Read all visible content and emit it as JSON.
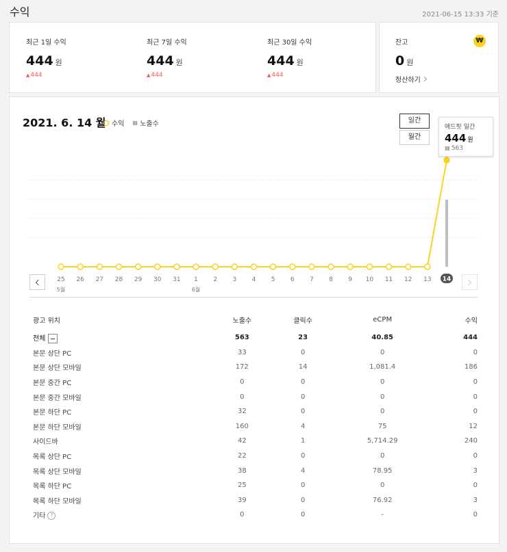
{
  "page": {
    "title": "수익",
    "timestamp": "2021-06-15 13:33 기준"
  },
  "revenue_stats": [
    {
      "label": "최근 1일 수익",
      "value": "444",
      "unit": "원",
      "diff": "444"
    },
    {
      "label": "최근 7일 수익",
      "value": "444",
      "unit": "원",
      "diff": "444"
    },
    {
      "label": "최근 30일 수익",
      "value": "444",
      "unit": "원",
      "diff": "444"
    }
  ],
  "balance": {
    "label": "잔고",
    "value": "0",
    "unit": "원",
    "settle_label": "정산하기",
    "icon": "₩"
  },
  "chart": {
    "date_title": "2021. 6. 14 월",
    "legend_revenue": "수익",
    "legend_impressions": "노출수",
    "btn_daily": "일간",
    "btn_monthly": "월간",
    "tooltip": {
      "title": "애드핏 일간",
      "value": "444",
      "unit": "원",
      "impressions": "563"
    },
    "accent_color": "#fbd21c",
    "bar_color": "#b9bfc4"
  },
  "chart_data": {
    "type": "line",
    "x": [
      "25",
      "26",
      "27",
      "28",
      "29",
      "30",
      "31",
      "1",
      "2",
      "3",
      "4",
      "5",
      "6",
      "7",
      "8",
      "9",
      "10",
      "11",
      "12",
      "13",
      "14"
    ],
    "month_labels": [
      {
        "index": 0,
        "label": "5월"
      },
      {
        "index": 7,
        "label": "6월"
      }
    ],
    "series": [
      {
        "name": "수익",
        "values": [
          0,
          0,
          0,
          0,
          0,
          0,
          0,
          0,
          0,
          0,
          0,
          0,
          0,
          0,
          0,
          0,
          0,
          0,
          0,
          0,
          444
        ]
      },
      {
        "name": "노출수",
        "values": [
          0,
          0,
          0,
          0,
          0,
          0,
          0,
          0,
          0,
          0,
          0,
          0,
          0,
          0,
          0,
          0,
          0,
          0,
          0,
          0,
          563
        ]
      }
    ],
    "selected_index": 20
  },
  "table": {
    "headers": [
      "광고 위치",
      "노출수",
      "클릭수",
      "eCPM",
      "수익"
    ],
    "total": {
      "label": "전체",
      "values": [
        "563",
        "23",
        "40.85",
        "444"
      ]
    },
    "rows": [
      {
        "label": "본문 상단 PC",
        "values": [
          "33",
          "0",
          "0",
          "0"
        ]
      },
      {
        "label": "본문 상단 모바일",
        "values": [
          "172",
          "14",
          "1,081.4",
          "186"
        ]
      },
      {
        "label": "본문 중간 PC",
        "values": [
          "0",
          "0",
          "0",
          "0"
        ]
      },
      {
        "label": "본문 중간 모바일",
        "values": [
          "0",
          "0",
          "0",
          "0"
        ]
      },
      {
        "label": "본문 하단 PC",
        "values": [
          "32",
          "0",
          "0",
          "0"
        ]
      },
      {
        "label": "본문 하단 모바일",
        "values": [
          "160",
          "4",
          "75",
          "12"
        ]
      },
      {
        "label": "사이드바",
        "values": [
          "42",
          "1",
          "5,714.29",
          "240"
        ]
      },
      {
        "label": "목록 상단 PC",
        "values": [
          "22",
          "0",
          "0",
          "0"
        ]
      },
      {
        "label": "목록 상단 모바일",
        "values": [
          "38",
          "4",
          "78.95",
          "3"
        ]
      },
      {
        "label": "목록 하단 PC",
        "values": [
          "25",
          "0",
          "0",
          "0"
        ]
      },
      {
        "label": "목록 하단 모바일",
        "values": [
          "39",
          "0",
          "76.92",
          "3"
        ]
      },
      {
        "label": "기타",
        "values": [
          "0",
          "0",
          "-",
          "0"
        ],
        "help": "?"
      }
    ]
  }
}
